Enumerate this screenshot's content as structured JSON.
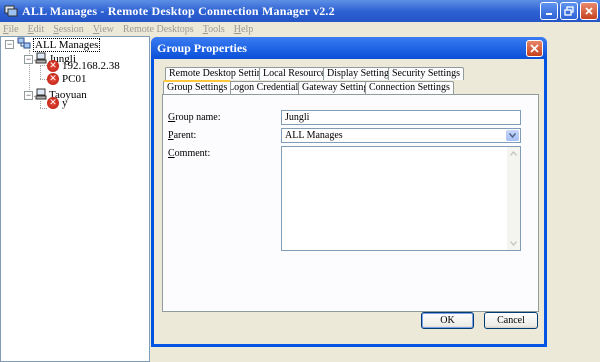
{
  "window": {
    "title": "ALL Manages - Remote Desktop Connection Manager v2.2"
  },
  "menu": {
    "items": [
      {
        "first": "F",
        "rest": "ile"
      },
      {
        "first": "E",
        "rest": "dit"
      },
      {
        "first": "S",
        "rest": "ession"
      },
      {
        "first": "V",
        "rest": "iew"
      },
      {
        "first": "",
        "rest": "Remote Desktops"
      },
      {
        "first": "T",
        "rest": "ools"
      },
      {
        "first": "H",
        "rest": "elp"
      }
    ]
  },
  "tree": {
    "root": "ALL Manages",
    "group1": "Jungli",
    "server1": "192.168.2.38",
    "server2": "PC01",
    "group2": "Taoyuan",
    "server3": "y"
  },
  "dialog": {
    "title": "Group Properties",
    "tabs_row1": [
      "Remote Desktop Settings",
      "Local Resources",
      "Display Settings",
      "Security Settings"
    ],
    "tabs_row2": [
      "Group Settings",
      "Logon Credentials",
      "Gateway Settings",
      "Connection Settings"
    ],
    "active_tab": "Group Settings",
    "group_name_label_first": "G",
    "group_name_label_rest": "roup name:",
    "group_name_value": "Jungli",
    "parent_label_first": "P",
    "parent_label_rest": "arent:",
    "parent_value": "ALL Manages",
    "comment_label_first": "C",
    "comment_label_rest": "omment:",
    "comment_value": "",
    "ok_label": "OK",
    "cancel_label": "Cancel"
  },
  "colors": {
    "titlebar": "#2c5fd1",
    "dialog_frame": "#0054e3",
    "tab_highlight": "#ffc83c",
    "error_icon": "#c62a1c"
  }
}
